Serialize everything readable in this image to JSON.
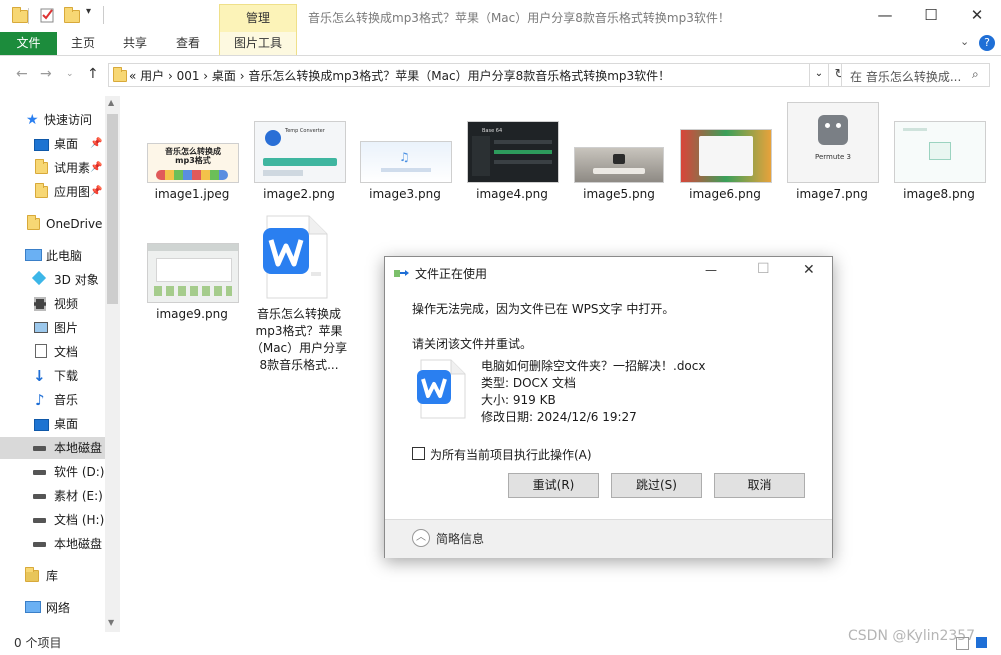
{
  "window": {
    "title": "音乐怎么转换成mp3格式？苹果（Mac）用户分享8款音乐格式转换mp3软件！",
    "manage_label": "管理",
    "minimize": "—",
    "maximize": "☐",
    "close": "✕"
  },
  "ribbon": {
    "tabs": [
      "文件",
      "主页",
      "共享",
      "查看",
      "图片工具"
    ],
    "collapse_icon": "chevron-down",
    "help_icon": "?"
  },
  "address": {
    "path": "«  用户  ›  001  ›  桌面  ›  音乐怎么转换成mp3格式？苹果（Mac）用户分享8款音乐格式转换mp3软件！",
    "search_placeholder": "在 音乐怎么转换成..."
  },
  "sidebar": {
    "items": [
      {
        "label": "快速访问",
        "icon": "star-icon"
      },
      {
        "label": "桌面",
        "icon": "desktop-icon"
      },
      {
        "label": "试用素",
        "icon": "folder-icon"
      },
      {
        "label": "应用图",
        "icon": "folder-icon"
      },
      {
        "label": "OneDrive",
        "icon": "folder-icon"
      },
      {
        "label": "此电脑",
        "icon": "pc-icon"
      },
      {
        "label": "3D 对象",
        "icon": "cube-icon"
      },
      {
        "label": "视频",
        "icon": "video-icon"
      },
      {
        "label": "图片",
        "icon": "picture-icon"
      },
      {
        "label": "文档",
        "icon": "document-icon"
      },
      {
        "label": "下载",
        "icon": "download-icon"
      },
      {
        "label": "音乐",
        "icon": "music-icon"
      },
      {
        "label": "桌面",
        "icon": "desktop-icon"
      },
      {
        "label": "本地磁盘",
        "icon": "drive-icon"
      },
      {
        "label": "软件 (D:)",
        "icon": "drive-icon"
      },
      {
        "label": "素材 (E:)",
        "icon": "drive-icon"
      },
      {
        "label": "文档 (H:)",
        "icon": "drive-icon"
      },
      {
        "label": "本地磁盘",
        "icon": "drive-icon"
      },
      {
        "label": "库",
        "icon": "library-icon"
      },
      {
        "label": "网络",
        "icon": "network-icon"
      }
    ]
  },
  "files": {
    "items": [
      {
        "name": "image1.jpeg",
        "thumb_text": "音乐怎么转换成\nmp3格式"
      },
      {
        "name": "image2.png",
        "thumb_text": "Temp Converter"
      },
      {
        "name": "image3.png"
      },
      {
        "name": "image4.png",
        "thumb_text": "Base 64"
      },
      {
        "name": "image5.png"
      },
      {
        "name": "image6.png"
      },
      {
        "name": "image7.png",
        "thumb_text": "Permute 3"
      },
      {
        "name": "image8.png"
      },
      {
        "name": "image9.png"
      },
      {
        "name": "音乐怎么转换成mp3格式？苹果（Mac）用户分享8款音乐格式..."
      }
    ]
  },
  "dialog": {
    "title": "文件正在使用",
    "message": "操作无法完成，因为文件已在 WPS文字 中打开。",
    "instruction": "请关闭该文件并重试。",
    "file_name": "电脑如何删除空文件夹？一招解决！.docx",
    "file_type": "类型: DOCX 文档",
    "file_size": "大小: 919 KB",
    "file_modified": "修改日期: 2024/12/6 19:27",
    "checkbox_label": "为所有当前项目执行此操作(A)",
    "retry": "重试(R)",
    "skip": "跳过(S)",
    "cancel": "取消",
    "details": "简略信息",
    "minimize": "—",
    "maximize": "☐",
    "close": "✕"
  },
  "status": {
    "count": "0 个项目"
  },
  "watermark": "CSDN @Kylin2357",
  "colors": {
    "file_tab": "#1c8c3c",
    "manage_tab": "#fcf3b8",
    "wps_blue": "#2a7ff0",
    "selection": "#d9d9d9"
  }
}
